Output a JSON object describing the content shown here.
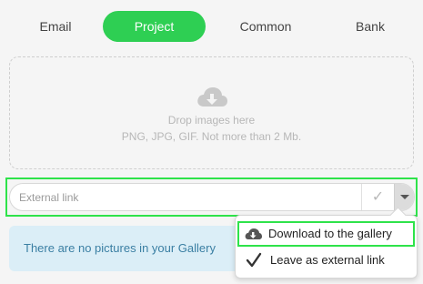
{
  "tabs": [
    {
      "label": "Email",
      "active": false
    },
    {
      "label": "Project",
      "active": true
    },
    {
      "label": "Common",
      "active": false
    },
    {
      "label": "Bank",
      "active": false
    }
  ],
  "dropzone": {
    "line1": "Drop images here",
    "line2": "PNG, JPG, GIF. Not more than 2 Mb.",
    "icon": "cloud-download-icon"
  },
  "external_link": {
    "placeholder": "External link",
    "value": "",
    "confirm_icon": "check-icon",
    "dropdown_icon": "caret-down-icon"
  },
  "info": {
    "message": "There are no pictures in your Gallery"
  },
  "menu": {
    "items": [
      {
        "label": "Download to the gallery",
        "icon": "cloud-download-icon",
        "highlighted": true
      },
      {
        "label": "Leave as external link",
        "icon": "check-icon",
        "highlighted": false
      }
    ]
  },
  "colors": {
    "accent": "#2ecf53",
    "highlight_outline": "#2ee34a",
    "info_bg": "#dbeef7",
    "info_text": "#3b7fa3"
  }
}
